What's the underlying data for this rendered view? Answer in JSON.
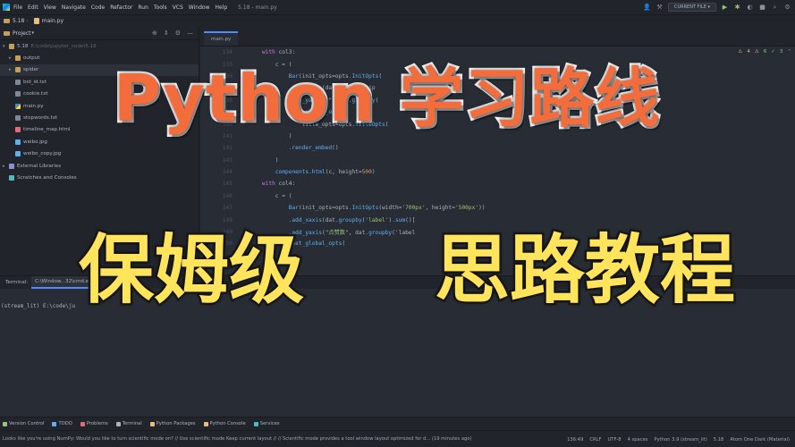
{
  "menubar": {
    "items": [
      "File",
      "Edit",
      "View",
      "Navigate",
      "Code",
      "Refactor",
      "Run",
      "Tools",
      "VCS",
      "Window",
      "Help"
    ],
    "window_title": "5.18 - main.py",
    "run_config": "CURRENT FILE ▾"
  },
  "breadcrumb": {
    "project": "5.18",
    "file": "main.py"
  },
  "project_panel": {
    "header": "Project",
    "root": {
      "name": "5.18",
      "path": "E:\\code\\jupyter_code\\5.18"
    },
    "items": [
      {
        "label": "output",
        "kind": "folder"
      },
      {
        "label": "spider",
        "kind": "folder"
      },
      {
        "label": "bid_id.txt",
        "kind": "txt"
      },
      {
        "label": "cookie.txt",
        "kind": "txt"
      },
      {
        "label": "main.py",
        "kind": "py"
      },
      {
        "label": "stopwords.txt",
        "kind": "txt"
      },
      {
        "label": "timeline_map.html",
        "kind": "html"
      },
      {
        "label": "weibo.jpg",
        "kind": "img"
      },
      {
        "label": "weibo_copy.jpg",
        "kind": "img"
      }
    ],
    "external_libraries": "External Libraries",
    "scratches": "Scratches and Consoles"
  },
  "editor": {
    "tab": "main.py",
    "inspections": {
      "warnings": "4",
      "weak": "6",
      "typos": "3"
    },
    "lines": [
      {
        "n": "134",
        "code": "    with col3:"
      },
      {
        "n": "135",
        "code": "        c = ("
      },
      {
        "n": "136",
        "code": "            Bar(init_opts=opts.InitOpts("
      },
      {
        "n": "137",
        "code": "            .add_xaxis(dat.groupby('ip"
      },
      {
        "n": "138",
        "code": "            .add_yaxis(\"\", dat.groupby("
      },
      {
        "n": "139",
        "code": "            .set_global_opts("
      },
      {
        "n": "140",
        "code": "                title_opts=opts.TitleOpts("
      },
      {
        "n": "141",
        "code": "            )"
      },
      {
        "n": "142",
        "code": "            .render_embed()"
      },
      {
        "n": "143",
        "code": "        )"
      },
      {
        "n": "144",
        "code": "        components.html(c, height=500)"
      },
      {
        "n": "145",
        "code": "    with col4:"
      },
      {
        "n": "146",
        "code": "        c = ("
      },
      {
        "n": "147",
        "code": "            Bar(init_opts=opts.InitOpts(width='700px', height='500px'))"
      },
      {
        "n": "148",
        "code": "            .add_xaxis(dat.groupby('label').sum()["
      },
      {
        "n": "149",
        "code": "            .add_yaxis(\"点赞数\", dat.groupby('label"
      },
      {
        "n": "150",
        "code": "            .set_global_opts("
      }
    ]
  },
  "terminal": {
    "tabs": [
      "Terminal:",
      "C:\\Window...32\\cmd.exe"
    ],
    "prompt": "(stream_lit) E:\\code\\ju"
  },
  "tool_windows": [
    "Version Control",
    "TODO",
    "Problems",
    "Terminal",
    "Python Packages",
    "Python Console",
    "Services"
  ],
  "status": {
    "message": "Looks like you're using NumPy: Would you like to turn scientific mode on? // Use scientific mode   Keep current layout // // Scientific mode provides a tool window layout optimized for d... (19 minutes ago)",
    "position": "136:49",
    "line_sep": "CRLF",
    "encoding": "UTF-8",
    "indent": "4 spaces",
    "interpreter": "Python 3.9 (stream_lit)",
    "project": "5.18",
    "theme": "Atom One Dark (Material)"
  },
  "overlay": {
    "title": "Python 学习路线",
    "left": "保姆级",
    "right": "思路教程"
  },
  "colors": {
    "title_fill": "#f36c3c",
    "caption_fill": "#ffe45c",
    "editor_bg": "#282c34",
    "accent": "#528bff"
  }
}
